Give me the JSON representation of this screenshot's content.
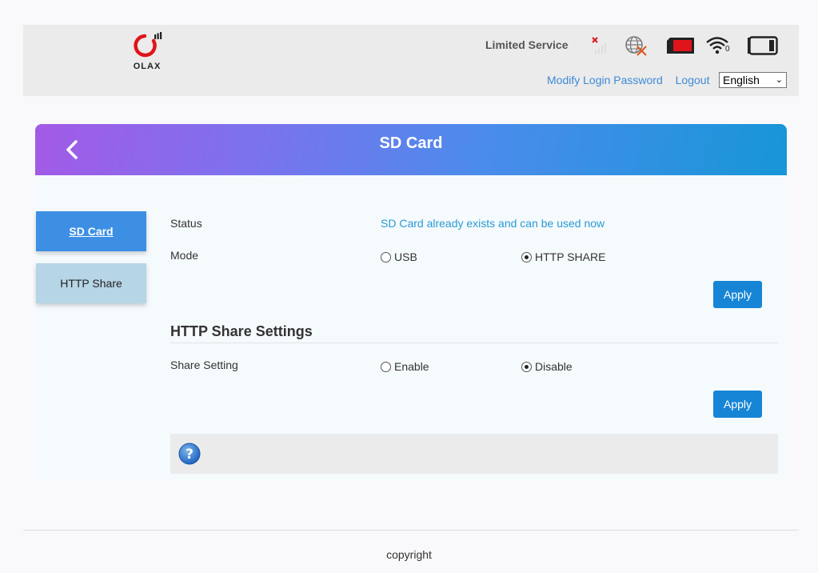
{
  "header": {
    "logo_text": "OLAX",
    "network_status": "Limited Service",
    "network_type": "0",
    "links": {
      "modify_password": "Modify Login Password",
      "logout": "Logout"
    },
    "language": {
      "selected": "English"
    }
  },
  "page": {
    "title": "SD Card"
  },
  "sidebar": {
    "items": [
      {
        "label": "SD Card",
        "active": true
      },
      {
        "label": "HTTP Share",
        "active": false
      }
    ]
  },
  "sd_card": {
    "status_label": "Status",
    "status_value": "SD Card already exists and can be used now",
    "mode_label": "Mode",
    "mode_options": [
      {
        "label": "USB",
        "checked": false
      },
      {
        "label": "HTTP SHARE",
        "checked": true
      }
    ],
    "apply_label": "Apply"
  },
  "http_share": {
    "section_title": "HTTP Share Settings",
    "share_label": "Share Setting",
    "share_options": [
      {
        "label": "Enable",
        "checked": false
      },
      {
        "label": "Disable",
        "checked": true
      }
    ],
    "apply_label": "Apply"
  },
  "help": {
    "icon": "question-icon"
  },
  "footer": {
    "copyright": "copyright"
  },
  "colors": {
    "accent": "#1785d6",
    "sidebar_active": "#3d8fe4",
    "sidebar_inactive": "#b6d5e6",
    "status_text": "#2a9bd3",
    "header_gradient_start": "#a35ae6",
    "header_gradient_end": "#1796d8",
    "sim_red": "#e0141b"
  }
}
